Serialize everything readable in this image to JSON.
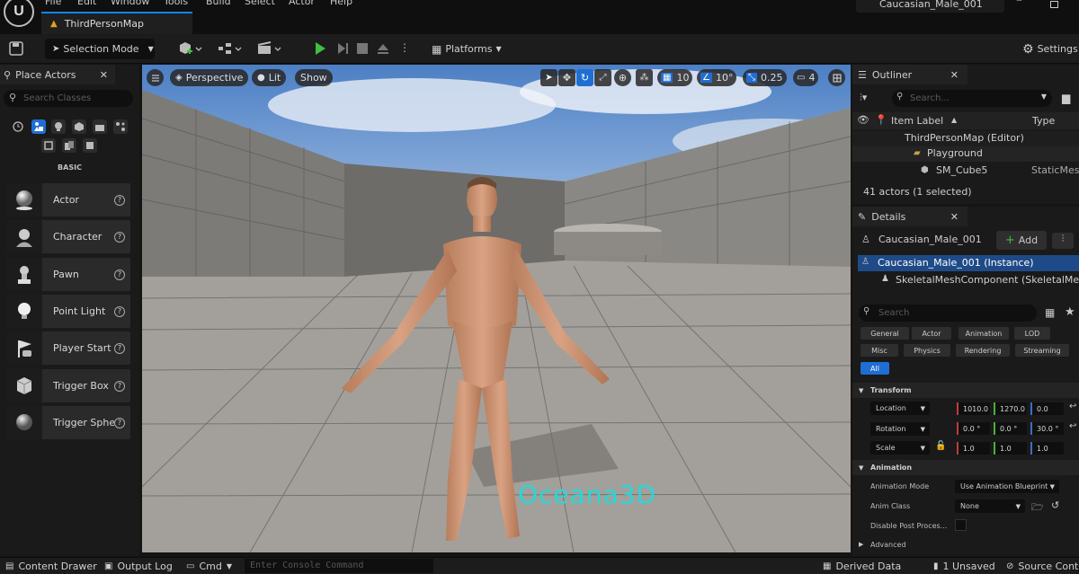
{
  "menubar": {
    "items": [
      "File",
      "Edit",
      "Window",
      "Tools",
      "Build",
      "Select",
      "Actor",
      "Help"
    ],
    "tab_title": "ThirdPersonMap",
    "project_name": "Caucasian_Male_001"
  },
  "toolbar": {
    "selection_mode": "Selection Mode",
    "platforms": "Platforms",
    "settings": "Settings"
  },
  "place_actors": {
    "tab_title": "Place Actors",
    "search_placeholder": "Search Classes",
    "category_label": "BASIC",
    "items": [
      "Actor",
      "Character",
      "Pawn",
      "Point Light",
      "Player Start",
      "Trigger Box",
      "Trigger Sphe"
    ]
  },
  "viewport": {
    "perspective": "Perspective",
    "lit": "Lit",
    "show": "Show",
    "grid_snap": "10",
    "rot_snap": "10°",
    "scale_snap": "0.25",
    "camera_speed": "4",
    "watermark": "Oceana3D"
  },
  "outliner": {
    "tab_title": "Outliner",
    "search_placeholder": "Search...",
    "col_label": "Item Label",
    "col_type": "Type",
    "rows": [
      {
        "label": "ThirdPersonMap (Editor)",
        "type": ""
      },
      {
        "label": "Playground",
        "type": ""
      },
      {
        "label": "SM_Cube5",
        "type": "StaticMes"
      }
    ],
    "count": "41 actors (1 selected)"
  },
  "details": {
    "tab_title": "Details",
    "actor_name": "Caucasian_Male_001",
    "add_label": "Add",
    "instance_label": "Caucasian_Male_001 (Instance)",
    "component_label": "SkeletalMeshComponent (SkeletalMeshC",
    "search_placeholder": "Search",
    "filters": [
      "General",
      "Actor",
      "Animation",
      "LOD",
      "Misc",
      "Physics",
      "Rendering",
      "Streaming",
      "All"
    ],
    "transform_section": "Transform",
    "location_label": "Location",
    "location": [
      "1010.0",
      "1270.0",
      "0.0"
    ],
    "rotation_label": "Rotation",
    "rotation": [
      "0.0 °",
      "0.0 °",
      "30.0 °"
    ],
    "scale_label": "Scale",
    "scale": [
      "1.0",
      "1.0",
      "1.0"
    ],
    "animation_section": "Animation",
    "anim_mode_label": "Animation Mode",
    "anim_mode_value": "Use Animation Blueprint",
    "anim_class_label": "Anim Class",
    "anim_class_value": "None",
    "disable_post_label": "Disable Post Proces...",
    "advanced_label": "Advanced"
  },
  "statusbar": {
    "content_drawer": "Content Drawer",
    "output_log": "Output Log",
    "cmd": "Cmd",
    "console_placeholder": "Enter Console Command",
    "derived_data": "Derived Data",
    "unsaved": "1 Unsaved",
    "source_control": "Source Contr"
  },
  "colors": {
    "accent_blue": "#0e86ff",
    "selection_blue": "#1f4a88",
    "play_green": "#3fbf3f",
    "watermark_cyan": "#27d8d8"
  }
}
